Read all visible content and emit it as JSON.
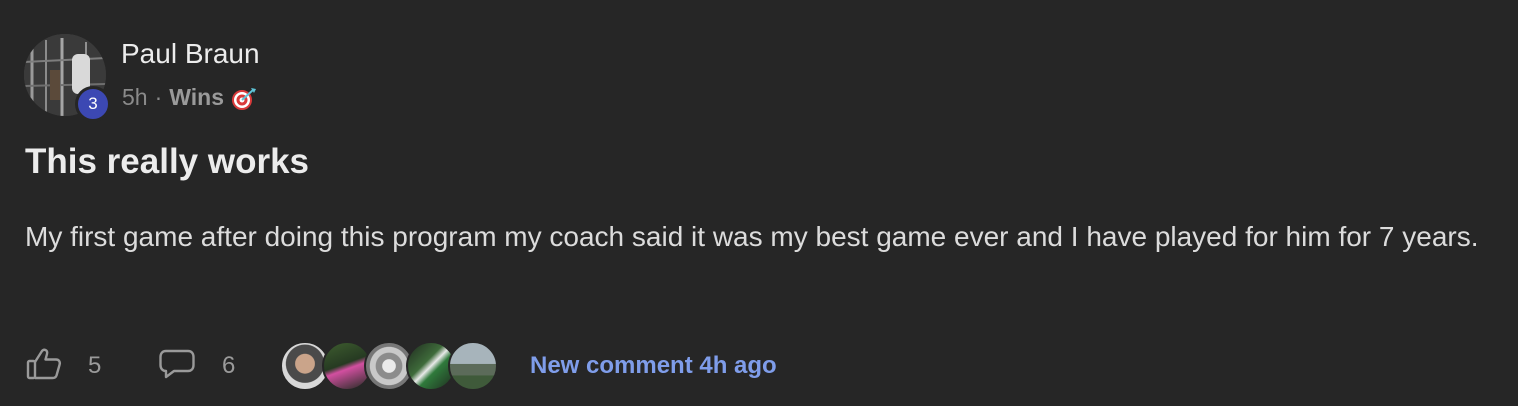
{
  "post": {
    "author": {
      "name": "Paul Braun",
      "level": "3"
    },
    "meta": {
      "time": "5h",
      "separator": "·",
      "category": "Wins",
      "category_icon": "dart-target-icon"
    },
    "title": "This really works",
    "body": "My first game after doing this program my coach said it was my best game ever and I have played for him for 7 years.",
    "footer": {
      "likes": "5",
      "comments": "6",
      "commenter_avatars": [
        "commenter-1",
        "commenter-2",
        "commenter-3",
        "commenter-4",
        "commenter-5"
      ],
      "new_comment_text": "New comment 4h ago"
    }
  },
  "colors": {
    "background": "#262626",
    "text_primary": "#ececec",
    "text_muted": "#8a8a8a",
    "level_badge": "#3c48b3",
    "link": "#7f9dea"
  }
}
